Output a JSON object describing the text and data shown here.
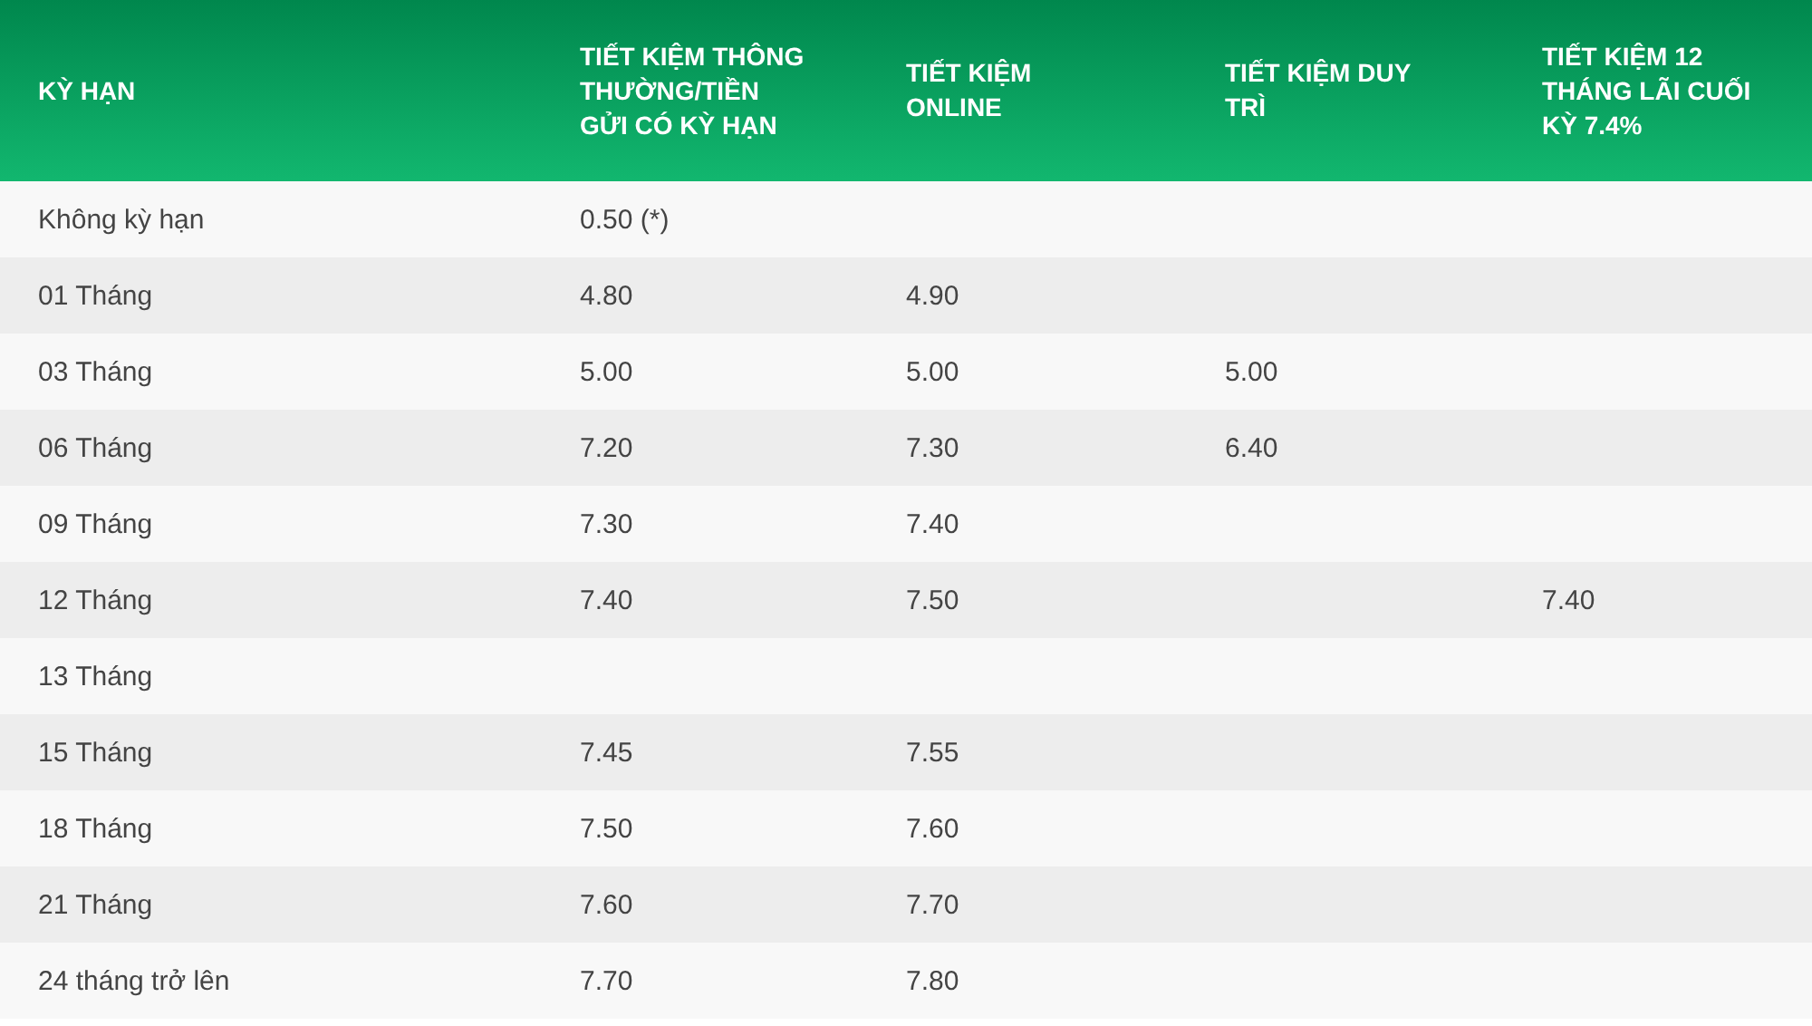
{
  "table": {
    "columns": [
      "KỲ HẠN",
      "TIẾT KIỆM THÔNG THƯỜNG/TIỀN GỬI CÓ KỲ HẠN",
      "TIẾT KIỆM ONLINE",
      "TIẾT KIỆM DUY TRÌ",
      "TIẾT KIỆM 12 THÁNG LÃI CUỐI KỲ 7.4%"
    ],
    "rows": [
      [
        "Không kỳ hạn",
        "0.50 (*)",
        null,
        null,
        null
      ],
      [
        "01 Tháng",
        "4.80",
        "4.90",
        null,
        null
      ],
      [
        "03 Tháng",
        "5.00",
        "5.00",
        "5.00",
        null
      ],
      [
        "06 Tháng",
        "7.20",
        "7.30",
        "6.40",
        null
      ],
      [
        "09 Tháng",
        "7.30",
        "7.40",
        null,
        null
      ],
      [
        "12 Tháng",
        "7.40",
        "7.50",
        null,
        "7.40"
      ],
      [
        "13 Tháng",
        null,
        null,
        null,
        null
      ],
      [
        "15 Tháng",
        "7.45",
        "7.55",
        null,
        null
      ],
      [
        "18 Tháng",
        "7.50",
        "7.60",
        null,
        null
      ],
      [
        "21 Tháng",
        "7.60",
        "7.70",
        null,
        null
      ],
      [
        "24 tháng trở lên",
        "7.70",
        "7.80",
        null,
        null
      ]
    ]
  }
}
